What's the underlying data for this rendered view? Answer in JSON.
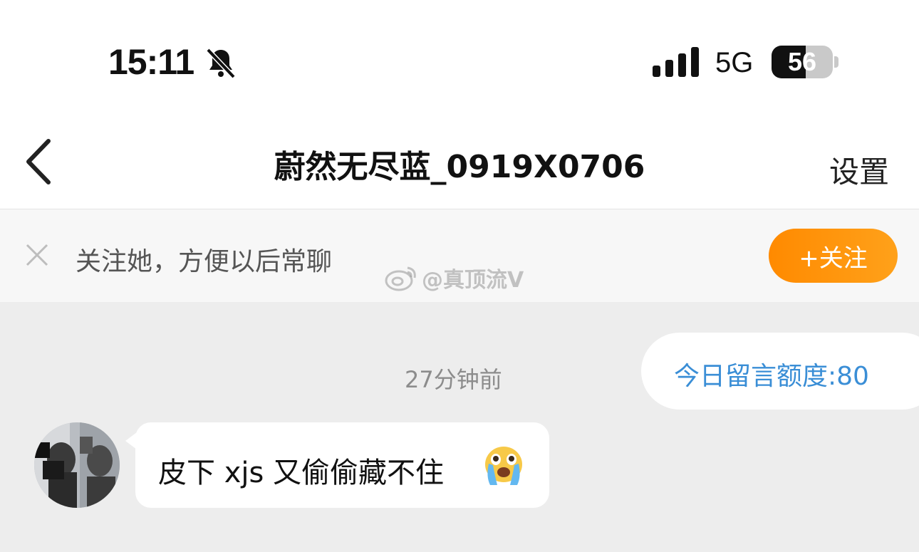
{
  "status_bar": {
    "time": "15:11",
    "muted_icon": "bell-slash-icon",
    "signal_icon": "cellular-signal-icon",
    "network": "5G",
    "battery_percent": 56
  },
  "nav": {
    "back_icon": "chevron-left-icon",
    "title": "蔚然无尽蓝_0919X0706",
    "settings_label": "设置"
  },
  "follow_banner": {
    "close_icon": "close-icon",
    "text": "关注她，方便以后常聊",
    "button_label": "+关注",
    "button_color": "#ff8a00"
  },
  "watermark": {
    "logo_icon": "weibo-logo-icon",
    "text": "@真顶流V"
  },
  "chat": {
    "timestamp": "27分钟前",
    "quota_text": "今日留言额度:80",
    "quota_color": "#3a8ed6",
    "messages": [
      {
        "sender": "other",
        "avatar_icon": "avatar",
        "text": "皮下 xjs 又偷偷藏不住",
        "emoji_icon": "loudly-crying-face-icon"
      }
    ]
  }
}
